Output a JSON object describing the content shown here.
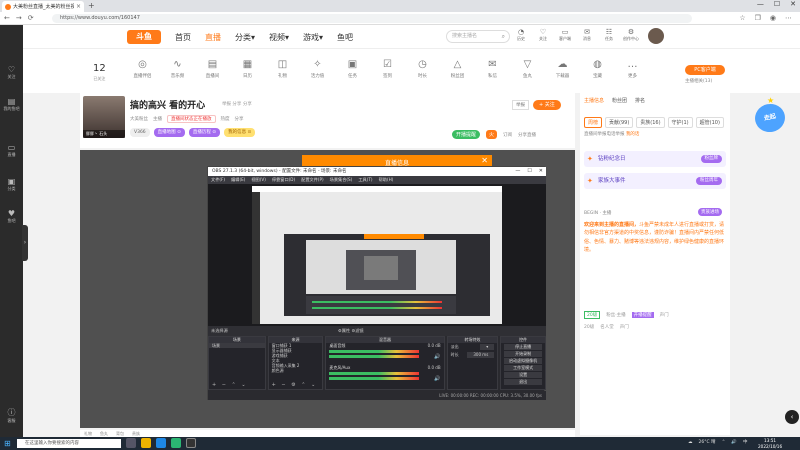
{
  "browser": {
    "tab_title": "大美粉丝直播_太美的粉丝视频直播_斗鱼直播",
    "url": "https://www.douyu.com/160147",
    "nav": [
      "←",
      "→",
      "⟳"
    ],
    "win_controls": [
      "—",
      "☐",
      "✕"
    ]
  },
  "sidebar": {
    "items": [
      {
        "icon": "♡",
        "label": "关注"
      },
      {
        "icon": "▤",
        "label": "我的鱼吧"
      },
      {
        "icon": "▭",
        "label": "直播"
      },
      {
        "icon": "▣",
        "label": "分类"
      },
      {
        "icon": "♥",
        "label": "鱼吧"
      },
      {
        "icon": "ⓘ",
        "label": "客服"
      }
    ],
    "handle": "›"
  },
  "header": {
    "logo": "斗鱼",
    "nav": [
      "首页",
      "直播",
      "分类▾",
      "视频▾",
      "游戏▾",
      "鱼吧"
    ],
    "search_placeholder": "搜索主播名",
    "icons": [
      {
        "icon": "◔",
        "label": "历史"
      },
      {
        "icon": "♡",
        "label": "关注"
      },
      {
        "icon": "▭",
        "label": "客户端"
      },
      {
        "icon": "✉",
        "label": "消息"
      },
      {
        "icon": "☷",
        "label": "任务"
      },
      {
        "icon": "⚙",
        "label": "创作中心"
      }
    ]
  },
  "categories": {
    "follow_count": "12",
    "follow_label": "已关注",
    "items": [
      {
        "icon": "◎",
        "label": "直播伴侣"
      },
      {
        "icon": "∿",
        "label": "音乐频"
      },
      {
        "icon": "▤",
        "label": "直播间"
      },
      {
        "icon": "▦",
        "label": "日历"
      },
      {
        "icon": "◫",
        "label": "礼物"
      },
      {
        "icon": "✧",
        "label": "活力值"
      },
      {
        "icon": "▣",
        "label": "任务"
      },
      {
        "icon": "☑",
        "label": "签到"
      },
      {
        "icon": "◷",
        "label": "时长"
      },
      {
        "icon": "△",
        "label": "粉丝团"
      },
      {
        "icon": "✉",
        "label": "私信"
      },
      {
        "icon": "▽",
        "label": "鱼丸"
      },
      {
        "icon": "☁",
        "label": "下载器"
      },
      {
        "icon": "◍",
        "label": "宝藏"
      },
      {
        "icon": "…",
        "label": "更多"
      }
    ],
    "pc_button": "PC客户端",
    "pc_sub": "主播相关(13)"
  },
  "room": {
    "avatar_caption": "胖胖丶 石头",
    "title": "搞的高兴 看的开心",
    "meta": "举报 分享 分享",
    "sub_line": [
      "大美粉丝",
      "主播",
      "热度",
      "分享"
    ],
    "highlight": "直播间状态正在播放",
    "tags": [
      {
        "label": "V366",
        "style": "grey"
      },
      {
        "label": "直播地图 ⊙",
        "style": "purple"
      },
      {
        "label": "直播历程 ⊙",
        "style": "purple"
      },
      {
        "label": "我的信息 ⊙",
        "style": "yellow"
      }
    ],
    "report": "举报",
    "follow": "+ 关注",
    "green_btn": "开播提醒",
    "fire": "火",
    "small1": "订阅",
    "small2": "分享直播"
  },
  "obs": {
    "popup_title": "直播信息",
    "popup_close": "✕",
    "title": "OBS 27.1.3 (64-bit, windows) - 配置文件: 未命名 - 场景: 未命名",
    "win_controls": [
      "—",
      "☐",
      "✕"
    ],
    "menu": [
      "文件(F)",
      "编辑(E)",
      "视图(V)",
      "停靠窗口(D)",
      "配置文件(P)",
      "场景集合(S)",
      "工具(T)",
      "帮助(H)"
    ],
    "scene_bar": "未选择源",
    "scene_bar_mid": "⚙属性   ⚙滤镜",
    "panels": {
      "scenes": "场景",
      "scene_items": [
        "场景"
      ],
      "sources": "来源",
      "source_items": [
        "窗口捕获 1",
        "显示器捕获",
        "游戏捕获",
        "文本",
        "音频输入采集 2",
        "颜色源"
      ],
      "mixer": "混音器",
      "mixer_rows": [
        {
          "name": "桌面音频",
          "db": "0.0 dB"
        },
        {
          "name": "麦克风/Aux",
          "db": "0.0 dB"
        }
      ],
      "transitions": "转场特效",
      "trans_rows": [
        [
          "淡出",
          "▾"
        ],
        [
          "时长",
          "300 ms"
        ]
      ],
      "controls": "控件",
      "control_buttons": [
        "停止直播",
        "开始录制",
        "启动虚拟摄像机",
        "工作室模式",
        "设置",
        "退出"
      ]
    },
    "status": "LIVE: 00:00:00   REC: 00:00:00   CPU: 3.5%, 30.00 fps"
  },
  "right_panel": {
    "tabs": [
      "主播信息",
      "粉丝团",
      "排名"
    ],
    "tabs2": [
      "周榜",
      "贡献(99)",
      "贵族(16)",
      "守护(1)",
      "超管(10)"
    ],
    "info_label": "直播间举报电话举报",
    "info_link": "我的话",
    "cards": [
      {
        "icon": "✦",
        "text": "钻粉纪念日",
        "badge": "粉丝牌"
      },
      {
        "icon": "✦",
        "text": "家族大事件",
        "badge": "粉丝周年"
      }
    ],
    "user_line": "BEGIN · 主播",
    "vip": "贵族进场",
    "msg_intro": "欢迎来到主播的直播间，",
    "msg": "斗鱼严禁未成年人进行直播或打赏，请勿相信非官方渠道的中奖信息，谨防诈骗！直播间内严禁任何低俗、色情、暴力、赌博等违法违规内容，维护绿色健康的直播环境。",
    "foot1": [
      "20级",
      "粉丝·主播",
      "开播提醒",
      "声门"
    ],
    "foot2": [
      "20级",
      "名人堂",
      "声门"
    ]
  },
  "game_badge": {
    "text": "走起",
    "star": "★"
  },
  "right_round_btn": "‹",
  "bottom_strip": [
    "礼物",
    "鱼丸",
    "背包",
    "贵族"
  ],
  "taskbar": {
    "start": "⊞",
    "search_placeholder": "在这里输入你要搜索的内容",
    "tray": [
      "☁",
      "26°C 晴",
      "⌃",
      "🔊",
      "中"
    ],
    "time": "13:51",
    "date": "2022/10/16"
  },
  "colors": {
    "accent": "#ff7a18",
    "purple": "#a46bf0",
    "green": "#3bbd62",
    "obs_bg": "#2a2a2f"
  }
}
